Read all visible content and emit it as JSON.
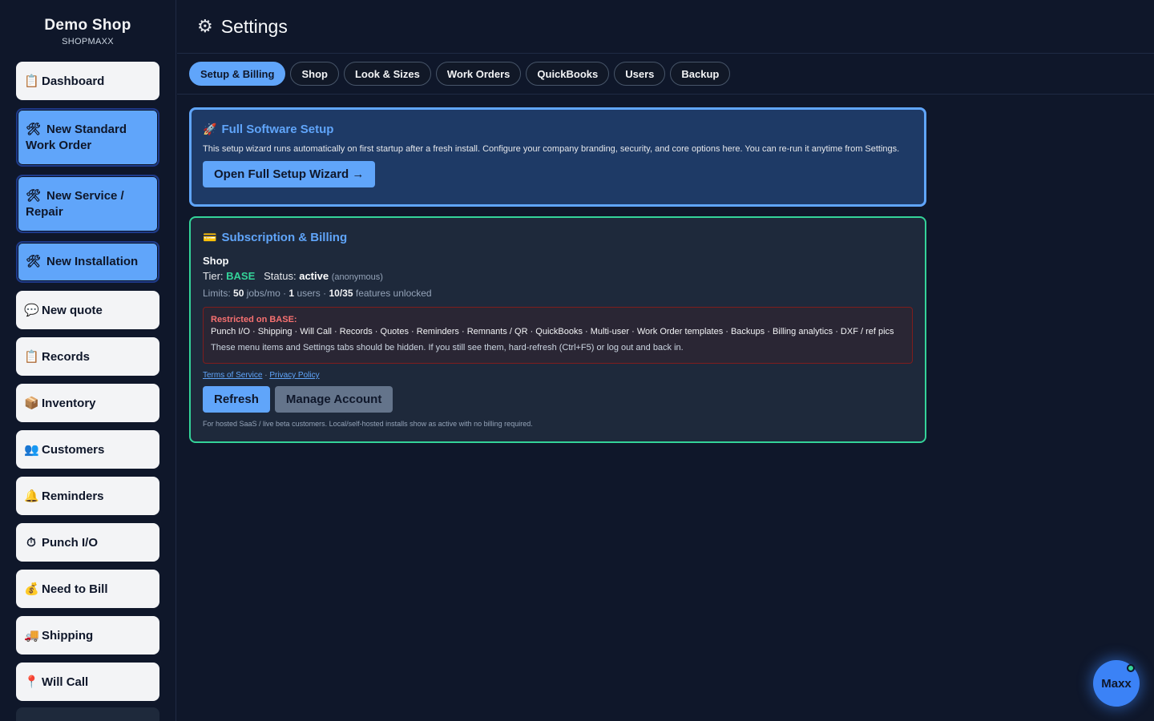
{
  "brand": {
    "name": "Demo Shop",
    "sub": "SHOPMAXX"
  },
  "sidebar": {
    "items": [
      {
        "icon": "📋",
        "label": "Dashboard"
      },
      {
        "icon": "🛠",
        "label": "New Standard Work Order"
      },
      {
        "icon": "🛠",
        "label": "New Service / Repair"
      },
      {
        "icon": "🛠",
        "label": "New Installation"
      },
      {
        "icon": "💬",
        "label": "New quote"
      },
      {
        "icon": "📋",
        "label": "Records"
      },
      {
        "icon": "📦",
        "label": "Inventory"
      },
      {
        "icon": "👥",
        "label": "Customers"
      },
      {
        "icon": "🔔",
        "label": "Reminders"
      },
      {
        "icon": "⏱",
        "label": "Punch I/O"
      },
      {
        "icon": "💰",
        "label": "Need to Bill"
      },
      {
        "icon": "🚚",
        "label": "Shipping"
      },
      {
        "icon": "📍",
        "label": "Will Call"
      }
    ]
  },
  "header": {
    "icon": "⚙",
    "title": "Settings"
  },
  "tabs": [
    {
      "label": "Setup & Billing",
      "active": true
    },
    {
      "label": "Shop"
    },
    {
      "label": "Look & Sizes"
    },
    {
      "label": "Work Orders"
    },
    {
      "label": "QuickBooks"
    },
    {
      "label": "Users"
    },
    {
      "label": "Backup"
    }
  ],
  "setup": {
    "icon": "🚀",
    "title": "Full Software Setup",
    "description": "This setup wizard runs automatically on first startup after a fresh install. Configure your company branding, security, and core options here. You can re-run it anytime from Settings.",
    "button": "Open Full Setup Wizard →"
  },
  "billing": {
    "icon": "💳",
    "title": "Subscription & Billing",
    "shop": "Shop",
    "tier_label": "Tier:",
    "tier": "BASE",
    "status_label": "Status:",
    "status": "active",
    "status_note": "(anonymous)",
    "limits_prefix": "Limits:",
    "jobs": "50",
    "jobs_unit": "jobs/mo ·",
    "users": "1",
    "users_unit": "users ·",
    "features": "10/35",
    "features_unit": "features unlocked",
    "restricted_title": "Restricted on BASE:",
    "restricted_list": "Punch I/O · Shipping · Will Call · Records · Quotes · Reminders · Remnants / QR · QuickBooks · Multi-user · Work Order templates · Backups · Billing analytics · DXF / ref pics",
    "restricted_note": "These menu items and Settings tabs should be hidden. If you still see them, hard-refresh (Ctrl+F5) or log out and back in.",
    "terms_link": "Terms of Service",
    "link_sep": "·",
    "privacy_link": "Privacy Policy",
    "refresh_button": "Refresh",
    "manage_button": "Manage Account",
    "footnote": "For hosted SaaS / live beta customers. Local/self-hosted installs show as active with no billing required."
  },
  "assistant": {
    "label": "Maxx"
  },
  "colors": {
    "background": "#0f172a",
    "accent": "#60a5fa",
    "success": "#34d399",
    "danger": "#f87171"
  }
}
